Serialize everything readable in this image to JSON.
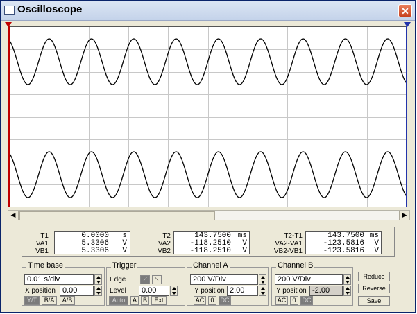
{
  "window": {
    "title": "Oscilloscope",
    "close": "✕"
  },
  "readouts": {
    "t1": {
      "labels": [
        "T1",
        "VA1",
        "VB1"
      ],
      "values": [
        "0.0000",
        "5.3306",
        "5.3306"
      ],
      "units": [
        "s",
        "V",
        "V"
      ]
    },
    "t2": {
      "labels": [
        "T2",
        "VA2",
        "VB2"
      ],
      "values": [
        "143.7500",
        "-118.2510",
        "-118.2510"
      ],
      "units": [
        "ms",
        "V",
        "V"
      ]
    },
    "diff": {
      "labels": [
        "T2-T1",
        "VA2-VA1",
        "VB2-VB1"
      ],
      "values": [
        "143.7500",
        "-123.5816",
        "-123.5816"
      ],
      "units": [
        "ms",
        "V",
        "V"
      ]
    }
  },
  "timebase": {
    "title": "Time base",
    "scale": "0.01 s/div",
    "xpos_label": "X position",
    "xpos": "0.00",
    "modes": [
      "Y/T",
      "B/A",
      "A/B"
    ]
  },
  "trigger": {
    "title": "Trigger",
    "edge_label": "Edge",
    "level_label": "Level",
    "level": "0.00",
    "modes": [
      "Auto",
      "A",
      "B",
      "Ext"
    ]
  },
  "channelA": {
    "title": "Channel A",
    "scale": "200 V/Div",
    "ypos_label": "Y position",
    "ypos": "2.00",
    "coupling": [
      "AC",
      "0",
      "DC"
    ]
  },
  "channelB": {
    "title": "Channel B",
    "scale": "200 V/Div",
    "ypos_label": "Y position",
    "ypos": "-2.00",
    "coupling": [
      "AC",
      "0",
      "DC"
    ]
  },
  "actions": {
    "reduce": "Reduce",
    "reverse": "Reverse",
    "save": "Save"
  }
}
